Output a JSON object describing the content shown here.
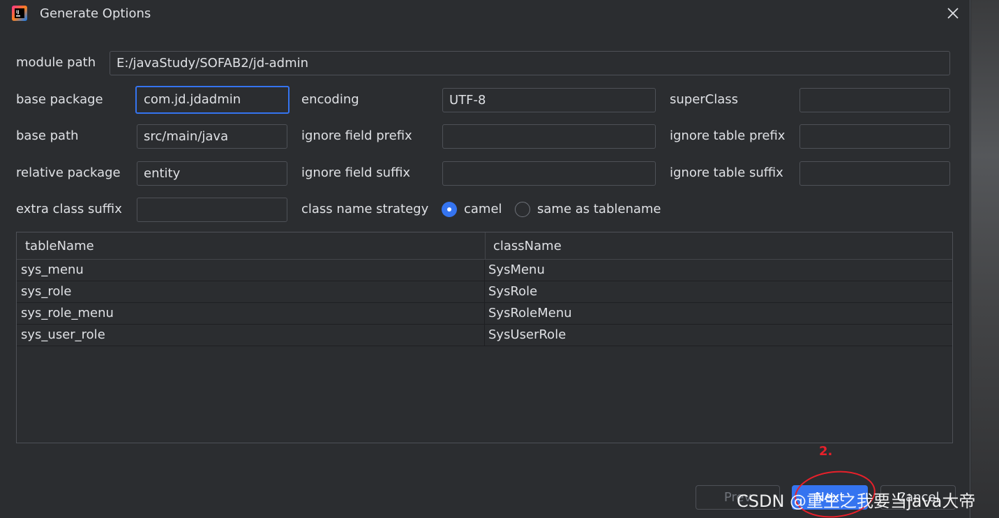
{
  "window": {
    "title": "Generate Options"
  },
  "form": {
    "module_path_label": "module path",
    "module_path_value": "E:/javaStudy/SOFAB2/jd-admin",
    "base_package_label": "base package",
    "base_package_value": "com.jd.jdadmin",
    "encoding_label": "encoding",
    "encoding_value": "UTF-8",
    "superclass_label": "superClass",
    "superclass_value": "",
    "base_path_label": "base path",
    "base_path_value": "src/main/java",
    "ignore_field_prefix_label": "ignore field prefix",
    "ignore_field_prefix_value": "",
    "ignore_table_prefix_label": "ignore table prefix",
    "ignore_table_prefix_value": "",
    "relative_package_label": "relative package",
    "relative_package_value": "entity",
    "ignore_field_suffix_label": "ignore field suffix",
    "ignore_field_suffix_value": "",
    "ignore_table_suffix_label": "ignore table suffix",
    "ignore_table_suffix_value": "",
    "extra_class_suffix_label": "extra class suffix",
    "extra_class_suffix_value": "",
    "class_name_strategy_label": "class name strategy",
    "strategy_options": [
      "camel",
      "same as tablename"
    ],
    "strategy_selected": "camel"
  },
  "table": {
    "columns": [
      "tableName",
      "className"
    ],
    "rows": [
      [
        "sys_menu",
        "SysMenu"
      ],
      [
        "sys_role",
        "SysRole"
      ],
      [
        "sys_role_menu",
        "SysRoleMenu"
      ],
      [
        "sys_user_role",
        "SysUserRole"
      ]
    ]
  },
  "buttons": {
    "prev": "Prev",
    "next": "Next",
    "cancel": "Cancel"
  },
  "annotation": {
    "step_number": "2."
  },
  "watermark": "CSDN @重生之我要当java大帝",
  "colors": {
    "background": "#2b2d30",
    "accent": "#3574f0",
    "annotation_red": "#e8202a"
  }
}
